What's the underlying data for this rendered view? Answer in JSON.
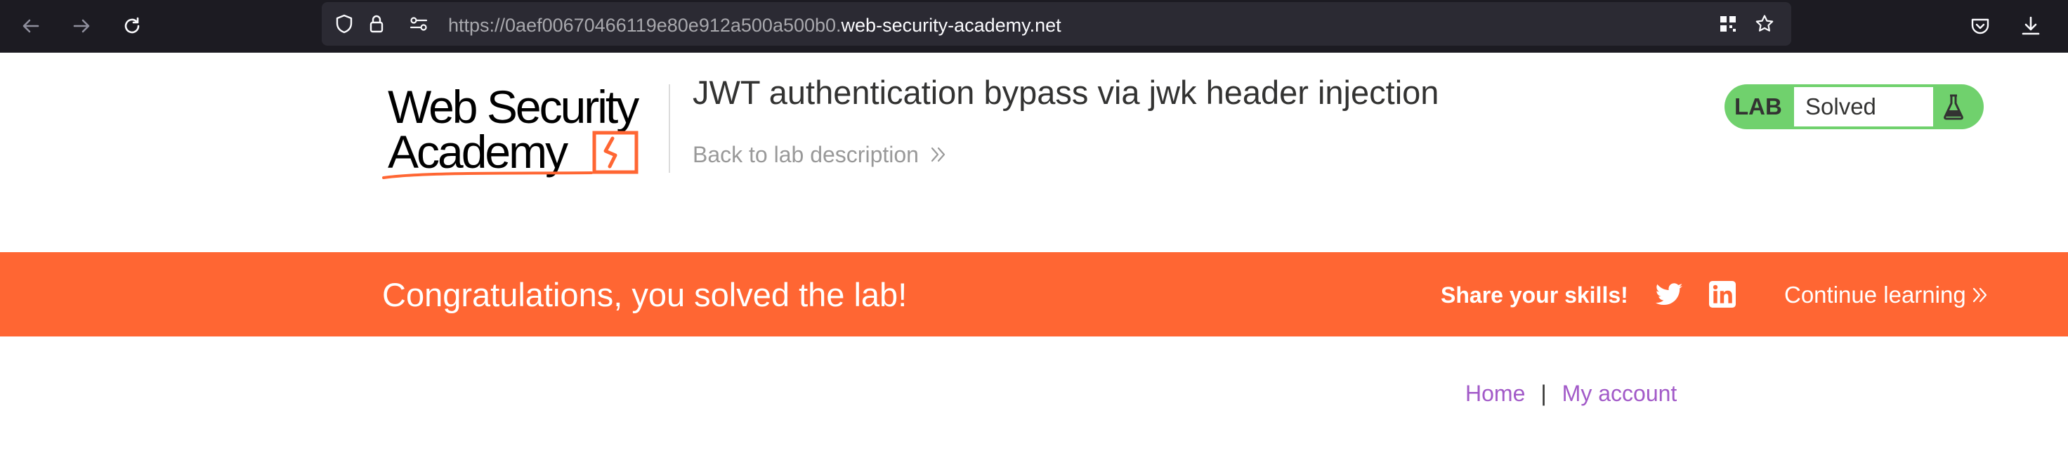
{
  "browser": {
    "url_prefix": "https://0aef00670466119e80e912a500a500b0.",
    "url_domain": "web-security-academy.net"
  },
  "header": {
    "logo_line1": "Web Security",
    "logo_line2": "Academy",
    "lab_title": "JWT authentication bypass via jwk header injection",
    "back_link": "Back to lab description",
    "lab_status_label": "LAB",
    "lab_status_value": "Solved"
  },
  "banner": {
    "message": "Congratulations, you solved the lab!",
    "share_label": "Share your skills!",
    "continue_label": "Continue learning"
  },
  "nav": {
    "home": "Home",
    "separator": "|",
    "my_account": "My account"
  },
  "colors": {
    "toolbar_bg": "#1c1b22",
    "banner_bg": "#ff6633",
    "lab_solved_green": "#70d16d",
    "nav_link": "#a25ac8"
  },
  "icons": [
    "back-arrow-icon",
    "forward-arrow-icon",
    "reload-icon",
    "shield-icon",
    "lock-icon",
    "permissions-icon",
    "qr-code-icon",
    "bookmark-star-icon",
    "pocket-icon",
    "download-icon",
    "flask-icon",
    "twitter-icon",
    "linkedin-icon",
    "double-chevron-right-icon"
  ]
}
